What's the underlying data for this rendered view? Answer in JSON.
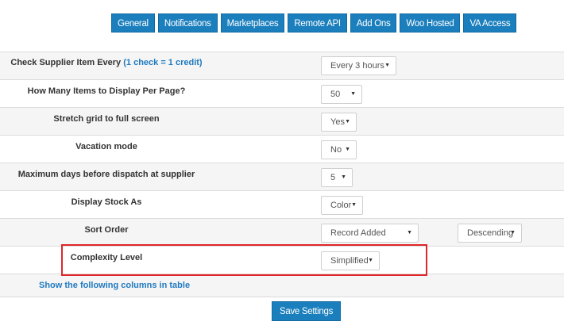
{
  "tabs": [
    "General",
    "Notifications",
    "Marketplaces",
    "Remote API",
    "Add Ons",
    "Woo Hosted",
    "VA Access"
  ],
  "settings": {
    "check_supplier": {
      "label": "Check Supplier Item Every",
      "note": "(1 check = 1 credit)",
      "value": "Every 3 hours"
    },
    "items_per_page": {
      "label": "How Many Items to Display Per Page?",
      "value": "50"
    },
    "stretch_grid": {
      "label": "Stretch grid to full screen",
      "value": "Yes"
    },
    "vacation_mode": {
      "label": "Vacation mode",
      "value": "No"
    },
    "max_days_dispatch": {
      "label": "Maximum days before dispatch at supplier",
      "value": "5"
    },
    "display_stock": {
      "label": "Display Stock As",
      "value": "Color"
    },
    "sort_order": {
      "label": "Sort Order",
      "value": "Record Added",
      "direction": "Descending"
    },
    "complexity_level": {
      "label": "Complexity Level",
      "value": "Simplified"
    }
  },
  "columns_link": "Show the following columns in table",
  "save_button": "Save Settings",
  "colors": {
    "accent": "#1b7fbd",
    "link": "#1f7ac0",
    "highlight": "#e0262a"
  },
  "icons": {
    "dropdown": "caret-down-icon"
  }
}
